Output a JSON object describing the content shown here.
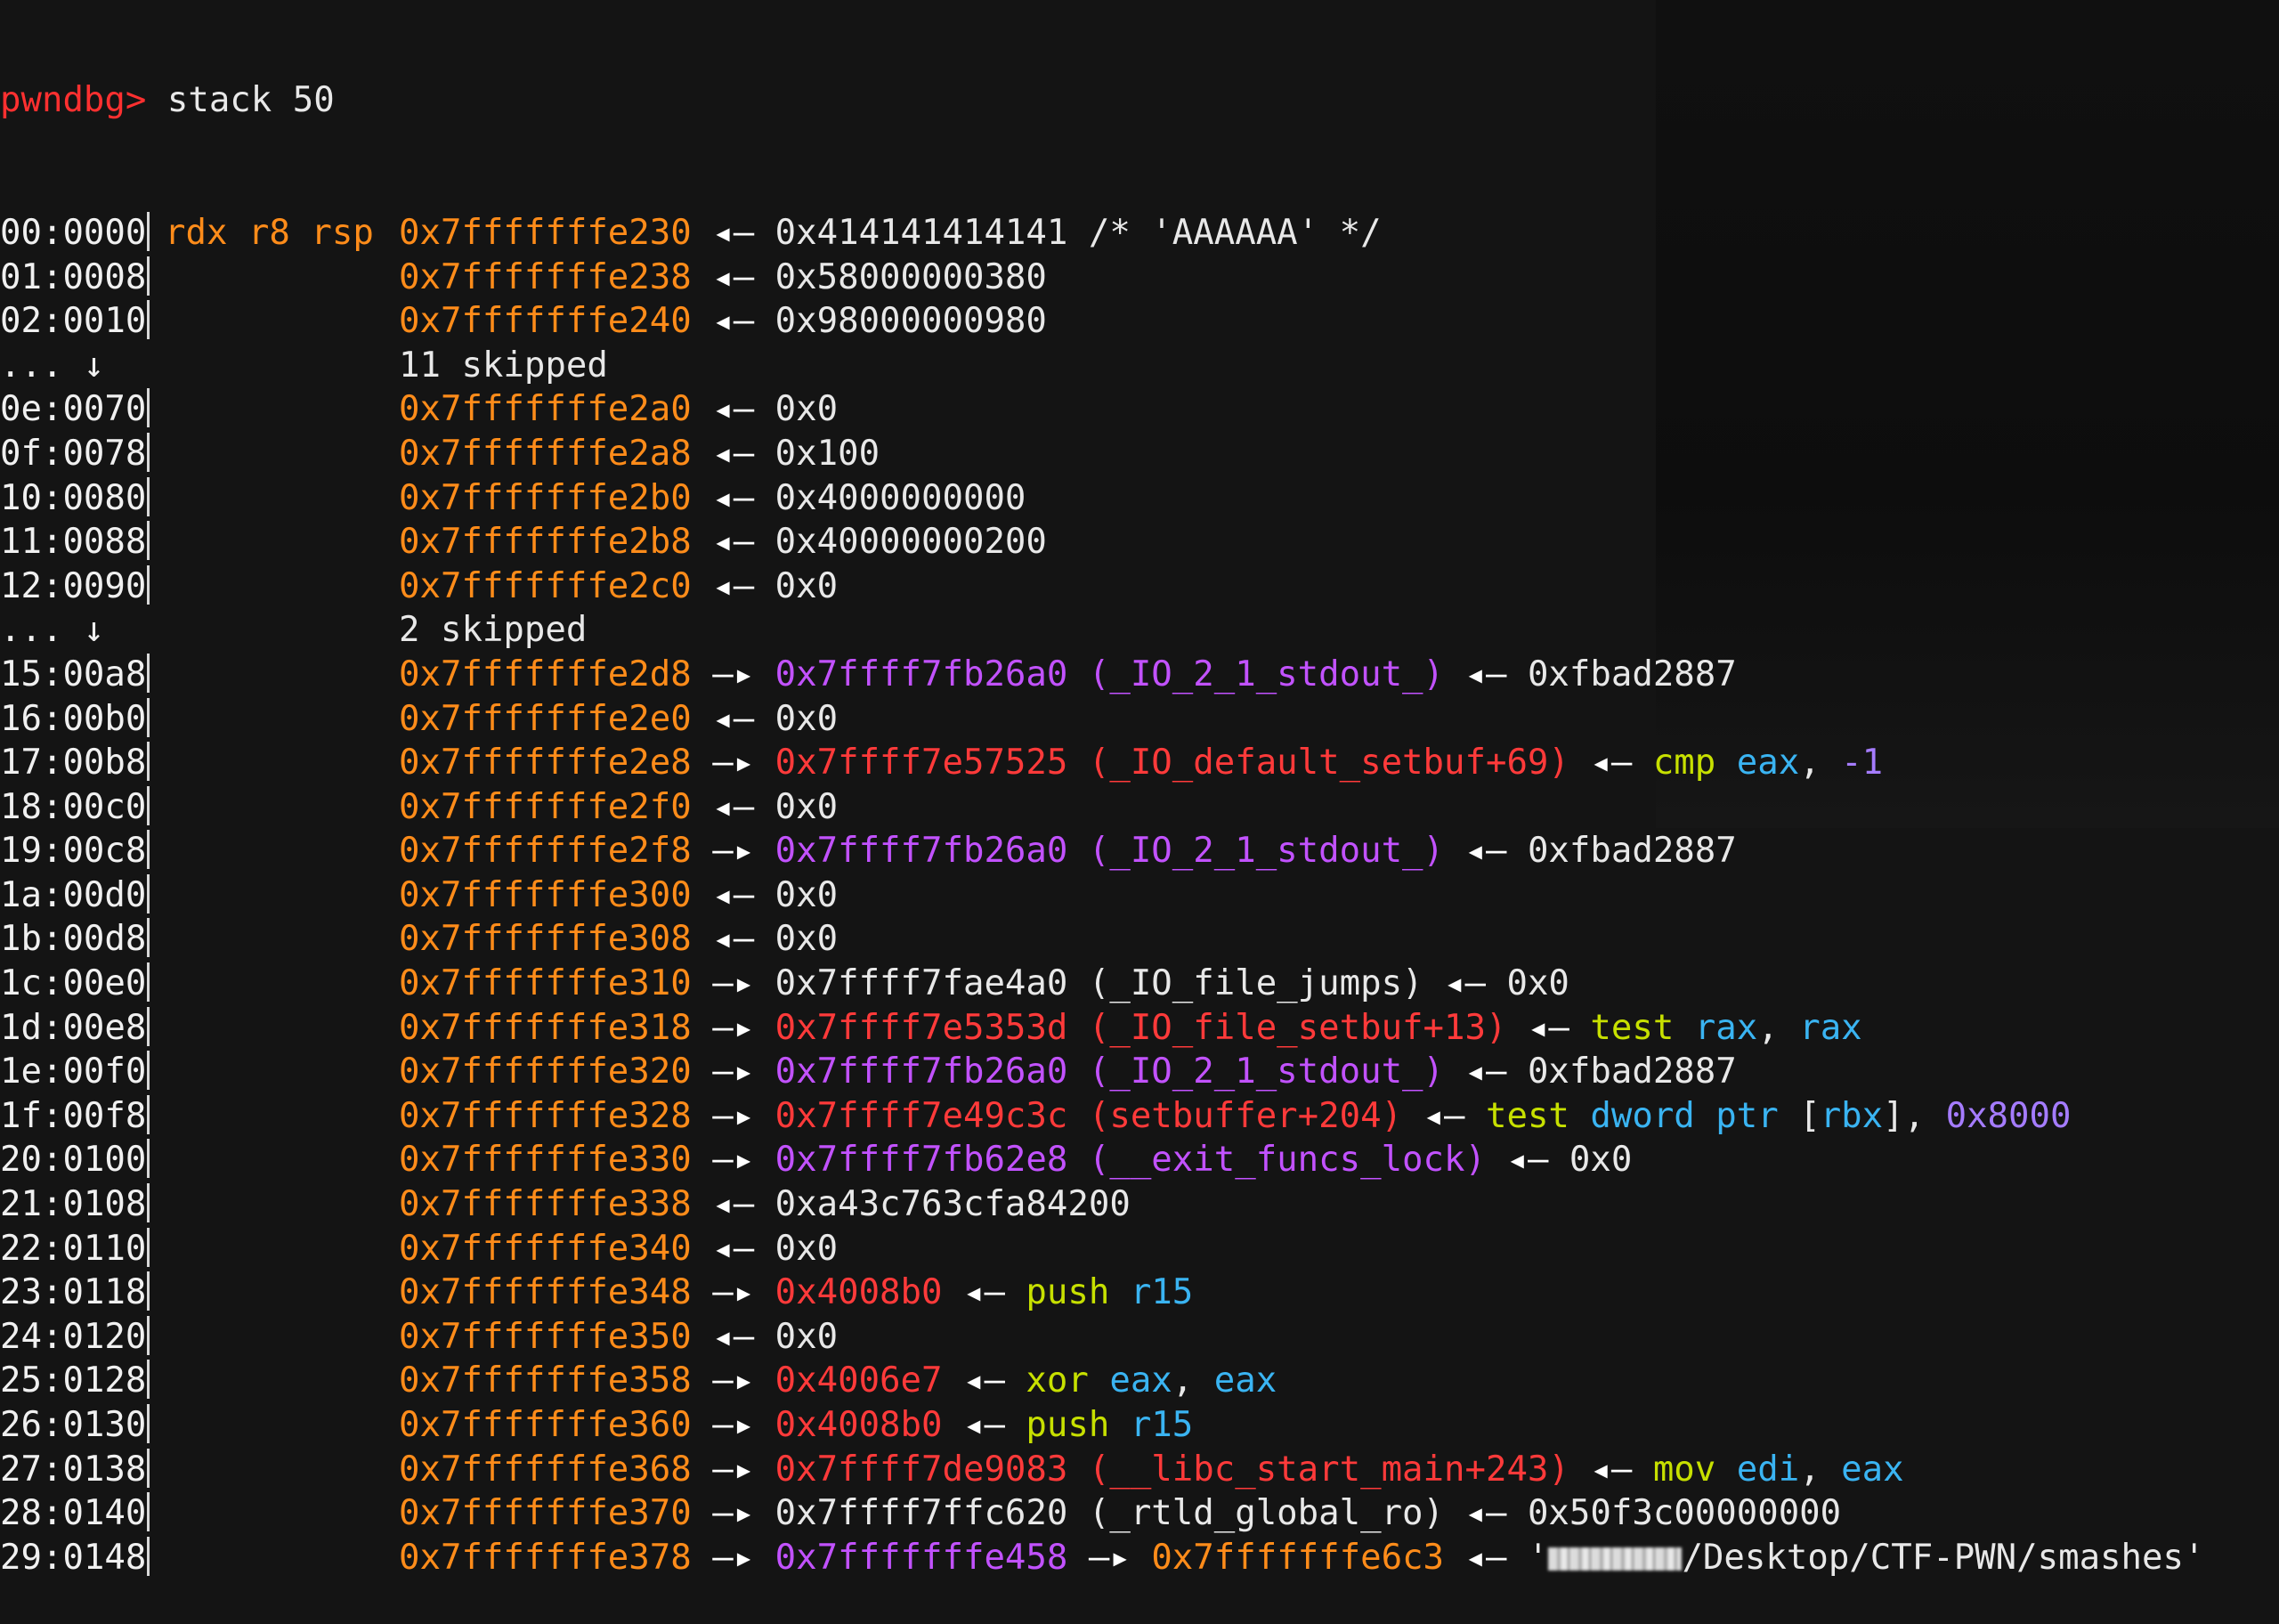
{
  "prompt": {
    "name": "pwndbg>",
    "command": " stack 50"
  },
  "arrows": {
    "points_to": "—▸",
    "holds": "◂—"
  },
  "rows": [
    {
      "kind": "entry",
      "offset": "00:0000",
      "regs": "rdx r8 rsp",
      "addr": "0x7fffffffe230",
      "arrow": "◂—",
      "target": [
        {
          "t": "0x414141414141 /* 'AAAAAA' */",
          "c": "white"
        }
      ]
    },
    {
      "kind": "entry",
      "offset": "01:0008",
      "regs": "",
      "addr": "0x7fffffffe238",
      "arrow": "◂—",
      "target": [
        {
          "t": "0x58000000380",
          "c": "white"
        }
      ]
    },
    {
      "kind": "entry",
      "offset": "02:0010",
      "regs": "",
      "addr": "0x7fffffffe240",
      "arrow": "◂—",
      "target": [
        {
          "t": "0x98000000980",
          "c": "white"
        }
      ]
    },
    {
      "kind": "skip",
      "dots": "... ↓",
      "text": "11 skipped"
    },
    {
      "kind": "entry",
      "offset": "0e:0070",
      "regs": "",
      "addr": "0x7fffffffe2a0",
      "arrow": "◂—",
      "target": [
        {
          "t": "0x0",
          "c": "white"
        }
      ]
    },
    {
      "kind": "entry",
      "offset": "0f:0078",
      "regs": "",
      "addr": "0x7fffffffe2a8",
      "arrow": "◂—",
      "target": [
        {
          "t": "0x100",
          "c": "white"
        }
      ]
    },
    {
      "kind": "entry",
      "offset": "10:0080",
      "regs": "",
      "addr": "0x7fffffffe2b0",
      "arrow": "◂—",
      "target": [
        {
          "t": "0x4000000000",
          "c": "white"
        }
      ]
    },
    {
      "kind": "entry",
      "offset": "11:0088",
      "regs": "",
      "addr": "0x7fffffffe2b8",
      "arrow": "◂—",
      "target": [
        {
          "t": "0x40000000200",
          "c": "white"
        }
      ]
    },
    {
      "kind": "entry",
      "offset": "12:0090",
      "regs": "",
      "addr": "0x7fffffffe2c0",
      "arrow": "◂—",
      "target": [
        {
          "t": "0x0",
          "c": "white"
        }
      ]
    },
    {
      "kind": "skip",
      "dots": "... ↓",
      "text": "2 skipped"
    },
    {
      "kind": "entry",
      "offset": "15:00a8",
      "regs": "",
      "addr": "0x7fffffffe2d8",
      "arrow": "—▸",
      "target": [
        {
          "t": "0x7ffff7fb26a0 (_IO_2_1_stdout_)",
          "c": "magenta"
        },
        {
          "t": " ◂— ",
          "c": "arrow"
        },
        {
          "t": "0xfbad2887",
          "c": "white"
        }
      ]
    },
    {
      "kind": "entry",
      "offset": "16:00b0",
      "regs": "",
      "addr": "0x7fffffffe2e0",
      "arrow": "◂—",
      "target": [
        {
          "t": "0x0",
          "c": "white"
        }
      ]
    },
    {
      "kind": "entry",
      "offset": "17:00b8",
      "regs": "",
      "addr": "0x7fffffffe2e8",
      "arrow": "—▸",
      "target": [
        {
          "t": "0x7ffff7e57525 (_IO_default_setbuf+69)",
          "c": "red"
        },
        {
          "t": " ◂— ",
          "c": "arrow"
        },
        {
          "t": "cmp ",
          "c": "green"
        },
        {
          "t": "eax",
          "c": "cyan"
        },
        {
          "t": ", ",
          "c": "white"
        },
        {
          "t": "-1",
          "c": "purple"
        }
      ]
    },
    {
      "kind": "entry",
      "offset": "18:00c0",
      "regs": "",
      "addr": "0x7fffffffe2f0",
      "arrow": "◂—",
      "target": [
        {
          "t": "0x0",
          "c": "white"
        }
      ]
    },
    {
      "kind": "entry",
      "offset": "19:00c8",
      "regs": "",
      "addr": "0x7fffffffe2f8",
      "arrow": "—▸",
      "target": [
        {
          "t": "0x7ffff7fb26a0 (_IO_2_1_stdout_)",
          "c": "magenta"
        },
        {
          "t": " ◂— ",
          "c": "arrow"
        },
        {
          "t": "0xfbad2887",
          "c": "white"
        }
      ]
    },
    {
      "kind": "entry",
      "offset": "1a:00d0",
      "regs": "",
      "addr": "0x7fffffffe300",
      "arrow": "◂—",
      "target": [
        {
          "t": "0x0",
          "c": "white"
        }
      ]
    },
    {
      "kind": "entry",
      "offset": "1b:00d8",
      "regs": "",
      "addr": "0x7fffffffe308",
      "arrow": "◂—",
      "target": [
        {
          "t": "0x0",
          "c": "white"
        }
      ]
    },
    {
      "kind": "entry",
      "offset": "1c:00e0",
      "regs": "",
      "addr": "0x7fffffffe310",
      "arrow": "—▸",
      "target": [
        {
          "t": "0x7ffff7fae4a0 (_IO_file_jumps)",
          "c": "white"
        },
        {
          "t": " ◂— ",
          "c": "arrow"
        },
        {
          "t": "0x0",
          "c": "white"
        }
      ]
    },
    {
      "kind": "entry",
      "offset": "1d:00e8",
      "regs": "",
      "addr": "0x7fffffffe318",
      "arrow": "—▸",
      "target": [
        {
          "t": "0x7ffff7e5353d (_IO_file_setbuf+13)",
          "c": "red"
        },
        {
          "t": " ◂— ",
          "c": "arrow"
        },
        {
          "t": "test ",
          "c": "green"
        },
        {
          "t": "rax",
          "c": "cyan"
        },
        {
          "t": ", ",
          "c": "white"
        },
        {
          "t": "rax",
          "c": "cyan"
        }
      ]
    },
    {
      "kind": "entry",
      "offset": "1e:00f0",
      "regs": "",
      "addr": "0x7fffffffe320",
      "arrow": "—▸",
      "target": [
        {
          "t": "0x7ffff7fb26a0 (_IO_2_1_stdout_)",
          "c": "magenta"
        },
        {
          "t": " ◂— ",
          "c": "arrow"
        },
        {
          "t": "0xfbad2887",
          "c": "white"
        }
      ]
    },
    {
      "kind": "entry",
      "offset": "1f:00f8",
      "regs": "",
      "addr": "0x7fffffffe328",
      "arrow": "—▸",
      "target": [
        {
          "t": "0x7ffff7e49c3c (setbuffer+204)",
          "c": "red"
        },
        {
          "t": " ◂— ",
          "c": "arrow"
        },
        {
          "t": "test ",
          "c": "green"
        },
        {
          "t": "dword ptr ",
          "c": "cyan"
        },
        {
          "t": "[",
          "c": "white"
        },
        {
          "t": "rbx",
          "c": "cyan"
        },
        {
          "t": "], ",
          "c": "white"
        },
        {
          "t": "0x8000",
          "c": "purple"
        }
      ]
    },
    {
      "kind": "entry",
      "offset": "20:0100",
      "regs": "",
      "addr": "0x7fffffffe330",
      "arrow": "—▸",
      "target": [
        {
          "t": "0x7ffff7fb62e8 (__exit_funcs_lock)",
          "c": "magenta"
        },
        {
          "t": " ◂— ",
          "c": "arrow"
        },
        {
          "t": "0x0",
          "c": "white"
        }
      ]
    },
    {
      "kind": "entry",
      "offset": "21:0108",
      "regs": "",
      "addr": "0x7fffffffe338",
      "arrow": "◂—",
      "target": [
        {
          "t": "0xa43c763cfa84200",
          "c": "white"
        }
      ]
    },
    {
      "kind": "entry",
      "offset": "22:0110",
      "regs": "",
      "addr": "0x7fffffffe340",
      "arrow": "◂—",
      "target": [
        {
          "t": "0x0",
          "c": "white"
        }
      ]
    },
    {
      "kind": "entry",
      "offset": "23:0118",
      "regs": "",
      "addr": "0x7fffffffe348",
      "arrow": "—▸",
      "target": [
        {
          "t": "0x4008b0",
          "c": "red"
        },
        {
          "t": " ◂— ",
          "c": "arrow"
        },
        {
          "t": "push ",
          "c": "green"
        },
        {
          "t": "r15",
          "c": "cyan"
        }
      ]
    },
    {
      "kind": "entry",
      "offset": "24:0120",
      "regs": "",
      "addr": "0x7fffffffe350",
      "arrow": "◂—",
      "target": [
        {
          "t": "0x0",
          "c": "white"
        }
      ]
    },
    {
      "kind": "entry",
      "offset": "25:0128",
      "regs": "",
      "addr": "0x7fffffffe358",
      "arrow": "—▸",
      "target": [
        {
          "t": "0x4006e7",
          "c": "red"
        },
        {
          "t": " ◂— ",
          "c": "arrow"
        },
        {
          "t": "xor ",
          "c": "green"
        },
        {
          "t": "eax",
          "c": "cyan"
        },
        {
          "t": ", ",
          "c": "white"
        },
        {
          "t": "eax",
          "c": "cyan"
        }
      ]
    },
    {
      "kind": "entry",
      "offset": "26:0130",
      "regs": "",
      "addr": "0x7fffffffe360",
      "arrow": "—▸",
      "target": [
        {
          "t": "0x4008b0",
          "c": "red"
        },
        {
          "t": " ◂— ",
          "c": "arrow"
        },
        {
          "t": "push ",
          "c": "green"
        },
        {
          "t": "r15",
          "c": "cyan"
        }
      ]
    },
    {
      "kind": "entry",
      "offset": "27:0138",
      "regs": "",
      "addr": "0x7fffffffe368",
      "arrow": "—▸",
      "target": [
        {
          "t": "0x7ffff7de9083 (__libc_start_main+243)",
          "c": "red"
        },
        {
          "t": " ◂— ",
          "c": "arrow"
        },
        {
          "t": "mov ",
          "c": "green"
        },
        {
          "t": "edi",
          "c": "cyan"
        },
        {
          "t": ", ",
          "c": "white"
        },
        {
          "t": "eax",
          "c": "cyan"
        }
      ]
    },
    {
      "kind": "entry",
      "offset": "28:0140",
      "regs": "",
      "addr": "0x7fffffffe370",
      "arrow": "—▸",
      "target": [
        {
          "t": "0x7ffff7ffc620 (_rtld_global_ro)",
          "c": "white"
        },
        {
          "t": " ◂— ",
          "c": "arrow"
        },
        {
          "t": "0x50f3c00000000",
          "c": "white"
        }
      ]
    },
    {
      "kind": "entry",
      "offset": "29:0148",
      "regs": "",
      "addr": "0x7fffffffe378",
      "arrow": "—▸",
      "target": [
        {
          "t": "0x7fffffffe458",
          "c": "magenta"
        },
        {
          "t": " —▸ ",
          "c": "arrow"
        },
        {
          "t": "0x7fffffffe6c3",
          "c": "addr"
        },
        {
          "t": " ◂— ",
          "c": "arrow"
        },
        {
          "t": "'",
          "c": "white"
        },
        {
          "t": "REDACTED",
          "c": "redact"
        },
        {
          "t": "/Desktop/CTF-PWN/smashes'",
          "c": "white"
        }
      ]
    }
  ],
  "colors": {
    "background": "#141414",
    "address": "#ff8c1a",
    "symbol_data": "#c252ff",
    "symbol_code": "#ff3a3a",
    "mnemonic": "#c7e000",
    "register": "#3ab4f2",
    "immediate": "#a57cff",
    "prompt": "#ff3030"
  }
}
